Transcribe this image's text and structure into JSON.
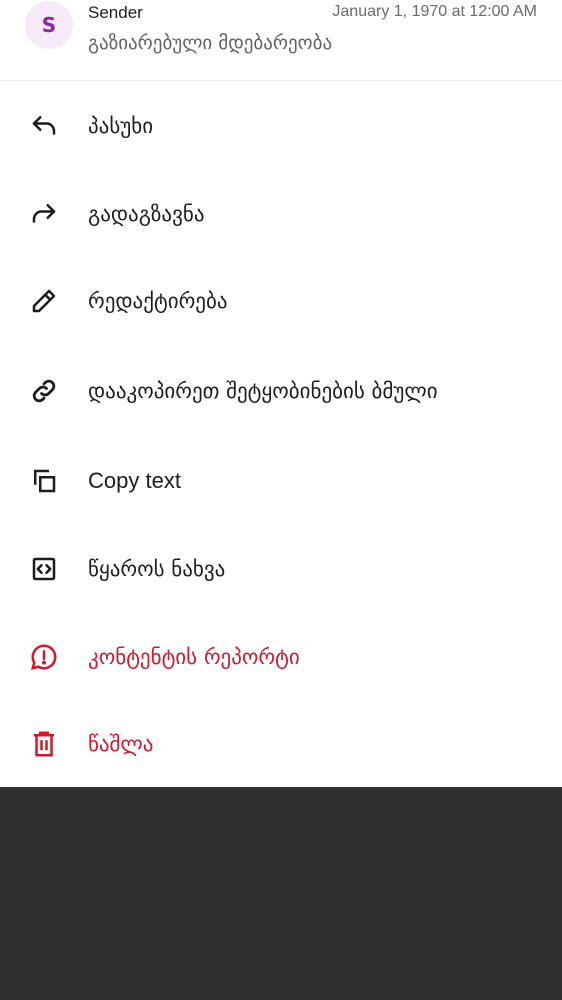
{
  "header": {
    "avatar_letter": "S",
    "sender": "Sender",
    "timestamp": "January 1, 1970 at 12:00 AM",
    "preview": "გაზიარებული მდებარეობა"
  },
  "menu": [
    {
      "label": "პასუხი",
      "icon": "reply-icon"
    },
    {
      "label": "გადაგზავნა",
      "icon": "forward-icon"
    },
    {
      "label": "რედაქტირება",
      "icon": "pencil-icon"
    },
    {
      "label": "დააკოპირეთ შეტყობინების ბმული",
      "icon": "link-icon"
    },
    {
      "label": "Copy text",
      "icon": "copy-icon"
    },
    {
      "label": "წყაროს ნახვა",
      "icon": "code-icon"
    },
    {
      "label": "კონტენტის რეპორტი",
      "icon": "report-icon",
      "color": "#d3182b"
    },
    {
      "label": "წაშლა",
      "icon": "trash-icon",
      "color": "#d3182b"
    }
  ],
  "colors": {
    "danger": "#d3182b",
    "avatar": "#8e24aa",
    "backdrop": "#303030"
  }
}
